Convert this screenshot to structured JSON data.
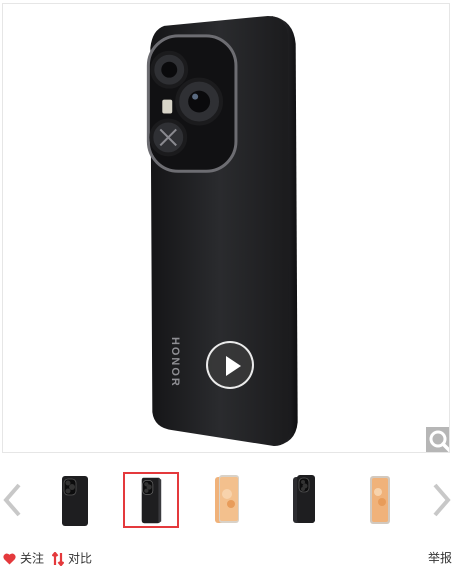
{
  "gallery": {
    "phone_brand_text": "HONOR",
    "play_icon": "play-icon",
    "zoom_icon": "magnifier-icon"
  },
  "thumbnails": {
    "prev_icon": "chevron-left-icon",
    "next_icon": "chevron-right-icon",
    "selected_index": 1,
    "items": [
      {
        "variant": "black-back"
      },
      {
        "variant": "black-back-angled"
      },
      {
        "variant": "orange-back-front"
      },
      {
        "variant": "black-back-front"
      },
      {
        "variant": "orange-back-side"
      }
    ]
  },
  "footer": {
    "follow_label": "关注",
    "compare_label": "对比",
    "report_label": "举报"
  },
  "colors": {
    "accent_red": "#e4393c",
    "phone_black": "#1e1e20",
    "phone_orange": "#f0b27a"
  }
}
